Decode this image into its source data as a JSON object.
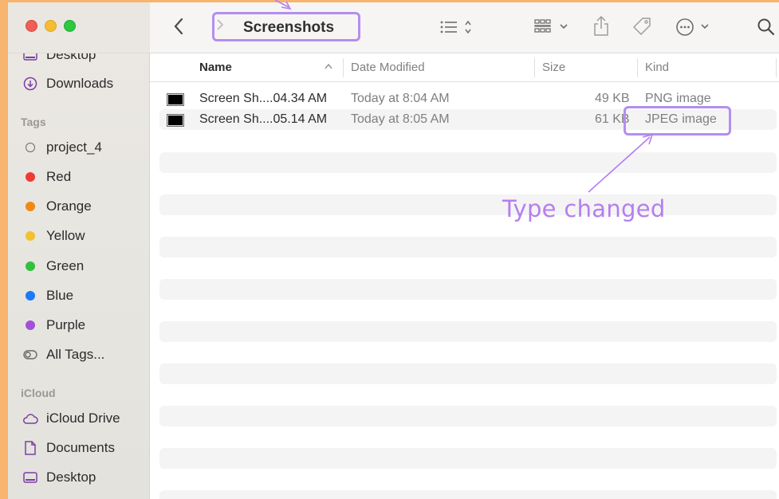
{
  "window": {
    "title": "Screenshots"
  },
  "sidebar": {
    "top_items": [
      {
        "label": "Desktop",
        "icon": "desktop-icon"
      },
      {
        "label": "Downloads",
        "icon": "download-icon"
      }
    ],
    "tags_header": "Tags",
    "tags": [
      {
        "label": "project_4",
        "color": ""
      },
      {
        "label": "Red",
        "color": "#ee3c33"
      },
      {
        "label": "Orange",
        "color": "#f08a14"
      },
      {
        "label": "Yellow",
        "color": "#f2c12e"
      },
      {
        "label": "Green",
        "color": "#31c03f"
      },
      {
        "label": "Blue",
        "color": "#1b7bf5"
      },
      {
        "label": "Purple",
        "color": "#a351d6"
      },
      {
        "label": "All Tags...",
        "color": ""
      }
    ],
    "icloud_header": "iCloud",
    "icloud_items": [
      {
        "label": "iCloud Drive",
        "icon": "cloud-icon"
      },
      {
        "label": "Documents",
        "icon": "document-icon"
      },
      {
        "label": "Desktop",
        "icon": "desktop-icon"
      }
    ]
  },
  "list": {
    "columns": [
      "Name",
      "Date Modified",
      "Size",
      "Kind"
    ],
    "sort_indicator": "^",
    "rows": [
      {
        "name": "Screen Sh....04.34 AM",
        "date": "Today at 8:04 AM",
        "size": "49 KB",
        "kind": "PNG image"
      },
      {
        "name": "Screen Sh....05.14 AM",
        "date": "Today at 8:05 AM",
        "size": "61 KB",
        "kind": "JPEG image"
      }
    ]
  },
  "annotation": {
    "text": "Type changed",
    "color": "#b57ef0"
  },
  "colors": {
    "highlight": "#b48ef0",
    "background": "#f7b46e"
  }
}
